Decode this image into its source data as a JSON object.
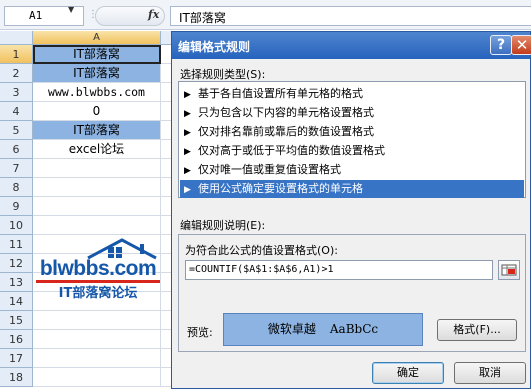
{
  "formula_bar": {
    "name_box": "A1",
    "fx_label": "fx",
    "formula": "IT部落窝"
  },
  "sheet": {
    "column_header": "A",
    "rows": [
      {
        "num": "1",
        "value": "IT部落窝",
        "highlight": true
      },
      {
        "num": "2",
        "value": "IT部落窝",
        "highlight": true
      },
      {
        "num": "3",
        "value": "www.blwbbs.com",
        "highlight": false
      },
      {
        "num": "4",
        "value": "0",
        "highlight": false
      },
      {
        "num": "5",
        "value": "IT部落窝",
        "highlight": true
      },
      {
        "num": "6",
        "value": "excel论坛",
        "highlight": false
      },
      {
        "num": "7",
        "value": "",
        "highlight": false
      },
      {
        "num": "8",
        "value": "",
        "highlight": false
      },
      {
        "num": "9",
        "value": "",
        "highlight": false
      },
      {
        "num": "10",
        "value": "",
        "highlight": false
      },
      {
        "num": "11",
        "value": "",
        "highlight": false
      },
      {
        "num": "12",
        "value": "",
        "highlight": false
      },
      {
        "num": "13",
        "value": "",
        "highlight": false
      },
      {
        "num": "14",
        "value": "",
        "highlight": false
      },
      {
        "num": "15",
        "value": "",
        "highlight": false
      },
      {
        "num": "16",
        "value": "",
        "highlight": false
      },
      {
        "num": "17",
        "value": "",
        "highlight": false
      },
      {
        "num": "18",
        "value": "",
        "highlight": false
      }
    ],
    "highlight_color": "#8db3e2"
  },
  "watermark": {
    "site": "blwbbs.com",
    "name": "IT部落窝论坛",
    "color": "#1557a8",
    "accent": "#d9261c"
  },
  "dialog": {
    "title": "编辑格式规则",
    "help_label": "?",
    "close_label": "✕",
    "rule_type_label": "选择规则类型(S):",
    "rule_types": [
      "基于各自值设置所有单元格的格式",
      "只为包含以下内容的单元格设置格式",
      "仅对排名靠前或靠后的数值设置格式",
      "仅对高于或低于平均值的数值设置格式",
      "仅对唯一值或重复值设置格式",
      "使用公式确定要设置格式的单元格"
    ],
    "selected_rule_index": 5,
    "rule_desc_label": "编辑规则说明(E):",
    "formula_label": "为符合此公式的值设置格式(O):",
    "formula": "=COUNTIF($A$1:$A$6,A1)>1",
    "preview_label": "预览:",
    "preview_text": "微软卓越",
    "preview_sample": "AaBbCc",
    "format_button": "格式(F)...",
    "ok_button": "确定",
    "cancel_button": "取消",
    "accent_color": "#3874c6"
  }
}
